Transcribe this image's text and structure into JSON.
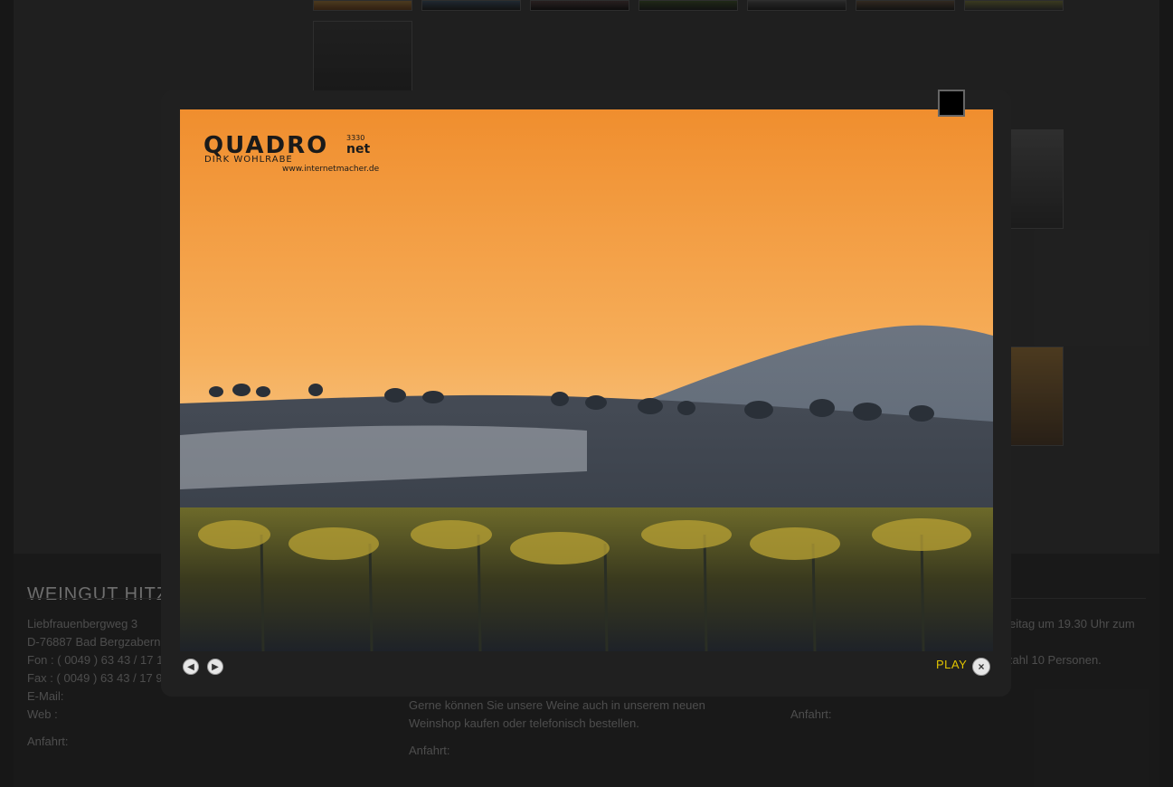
{
  "footer": {
    "title": "WEINGUT HITZ",
    "col1": {
      "address1": "Liebfrauenbergweg 3",
      "address2": "D-76887 Bad Bergzabern",
      "fon_label": "Fon :",
      "fon": "( 0049 ) 63 43 / 17 1",
      "fax_label": "Fax :",
      "fax": "( 0049 ) 63 43 / 17 9",
      "email_label": "E-Mail:",
      "email": "",
      "web_label": "Web :",
      "web": "",
      "anfahrt_label": "Anfahrt:",
      "anfahrt": ""
    },
    "col2": {
      "text1": "Gerne können Sie unsere Weine auch in unserem neuen",
      "text2": "Weinshop kaufen oder telefonisch bestellen.",
      "anfahrt_label": "Anfahrt:",
      "anfahrt": ""
    },
    "col3": {
      "text1": "eitag um 19.30 Uhr zum",
      "text2": "zahl 10 Personen.",
      "anfahrt_label": "Anfahrt:",
      "anfahrt": ""
    }
  },
  "lightbox": {
    "photo_logo": "QUADRO",
    "photo_logo_suffix": "net",
    "photo_logo_small": "3330",
    "photo_name": "DIRK WOHLRABE",
    "photo_url": "www.internetmacher.de",
    "play_label": "PLAY",
    "prev_icon": "prev-arrow-icon",
    "next_icon": "next-arrow-icon",
    "close_icon": "close-x-icon"
  },
  "colors": {
    "link": "#9b1c1c",
    "play": "#e0c300",
    "sky_top": "#f29a3a",
    "sky_bottom": "#f7c277"
  }
}
